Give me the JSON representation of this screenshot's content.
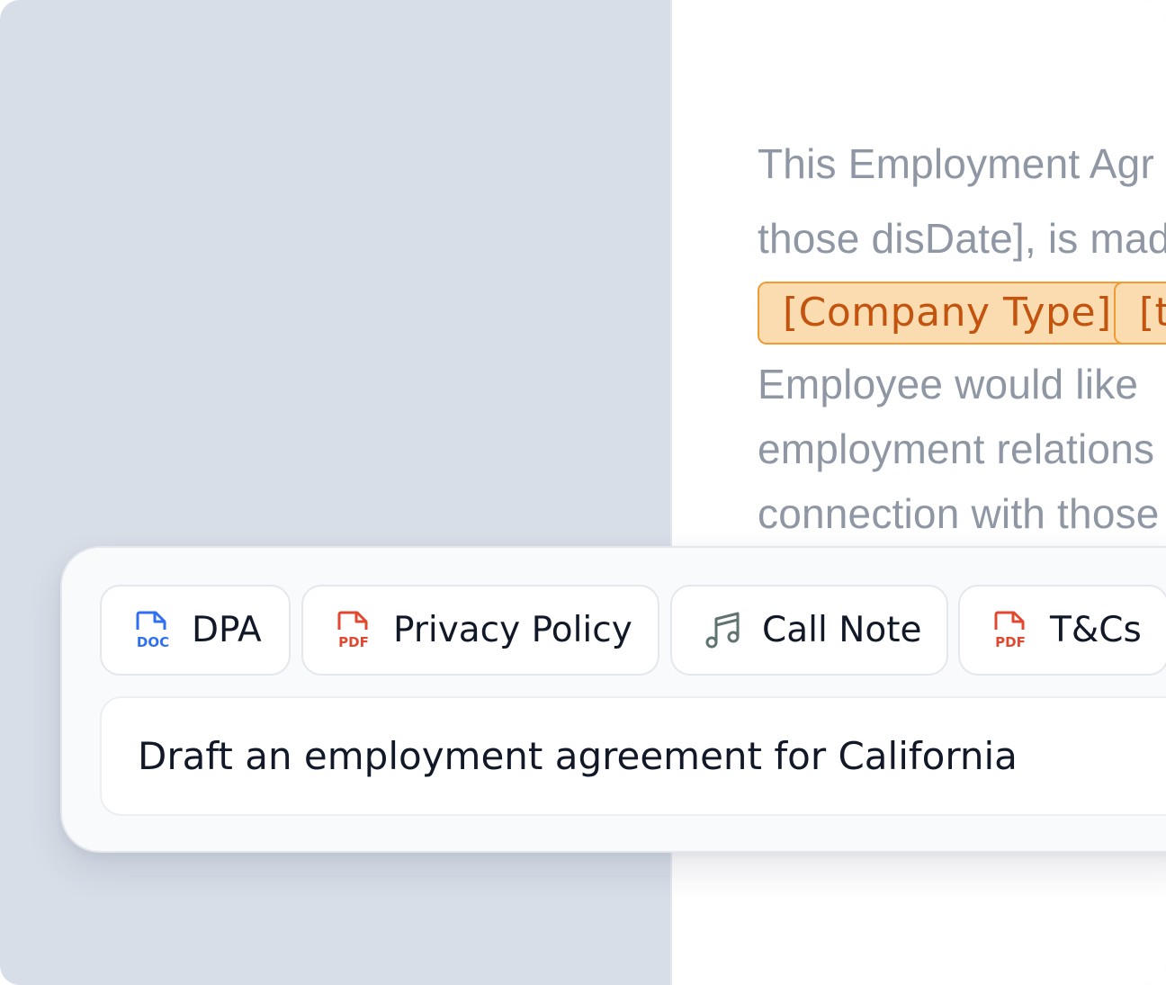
{
  "document": {
    "lines": [
      "This Employment Agr",
      "those disDate], is mad",
      " Employee would like",
      "employment relations",
      "connection with those"
    ],
    "tags": [
      "[Company Type]",
      "[ty"
    ],
    "tag_colors": {
      "fill": "#fbdcb0",
      "border": "#ef9c35",
      "text": "#c3540f"
    }
  },
  "composer": {
    "attachments": [
      {
        "label": "DPA",
        "icon": "doc-file-icon",
        "badge": "DOC",
        "color": "#2f6ff0"
      },
      {
        "label": "Privacy Policy",
        "icon": "pdf-file-icon",
        "badge": "PDF",
        "color": "#e2482f"
      },
      {
        "label": "Call Note",
        "icon": "music-note-icon",
        "color": "#5f7370"
      },
      {
        "label": "T&Cs",
        "icon": "pdf-file-icon",
        "badge": "PDF",
        "color": "#e2482f"
      }
    ],
    "prompt": "Draft an employment agreement for California"
  }
}
